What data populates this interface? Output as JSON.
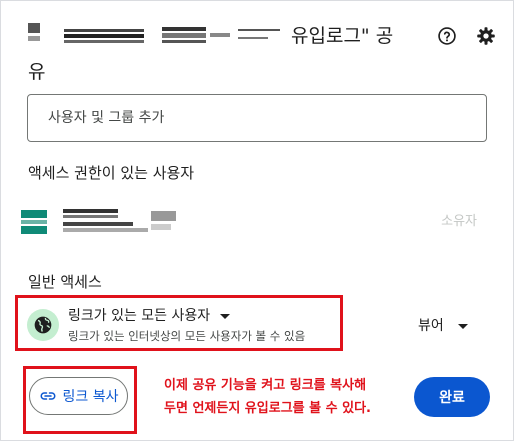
{
  "header": {
    "title_suffix": "유입로그\" 공",
    "title_line2": "유",
    "help_icon": "help-circle-icon",
    "settings_icon": "gear-icon"
  },
  "add_people": {
    "placeholder": "사용자 및 그룹 추가"
  },
  "people_with_access": {
    "heading": "액세스 권한이 있는 사용자",
    "owner_role": "소유자"
  },
  "general_access": {
    "heading": "일반 액세스",
    "selected_option": "링크가 있는 모든 사용자",
    "description": "링크가 있는 인터넷상의 모든 사용자가 볼 수 있음",
    "role": "뷰어",
    "icon": "globe-icon"
  },
  "footer": {
    "copy_link_label": "링크 복사",
    "copy_link_icon": "link-icon",
    "annotation_line1": "이제 공유 기능을 켜고 링크를 복사해",
    "annotation_line2": "두면 언제든지 유입로그를 볼 수 있다.",
    "done_label": "완료"
  },
  "colors": {
    "accent": "#0b57d0",
    "annotation_red": "#e0121b",
    "globe_bg": "#c4eed0",
    "owner_avatar": "#0f8a77"
  }
}
